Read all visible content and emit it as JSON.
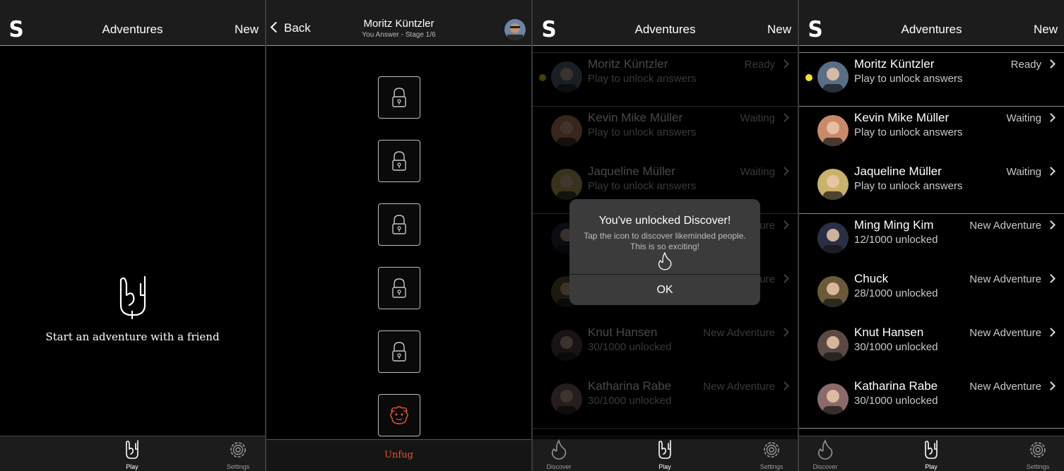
{
  "screen1": {
    "logo": "S",
    "title": "Adventures",
    "new_label": "New",
    "empty_text": "Start an adventure with a friend",
    "tabs": [
      {
        "label": "Play",
        "icon": "rock-hand-icon",
        "active": true
      },
      {
        "label": "Settings",
        "icon": "gear-icon",
        "active": false
      }
    ]
  },
  "screen2": {
    "back_label": "Back",
    "name": "Moritz Küntzler",
    "subtitle": "You Answer - Stage 1/6",
    "stages": [
      {
        "icon": "lock-icon"
      },
      {
        "icon": "lock-icon"
      },
      {
        "icon": "lock-icon"
      },
      {
        "icon": "lock-icon"
      },
      {
        "icon": "lock-icon"
      },
      {
        "icon": "mascot-icon"
      }
    ],
    "footer_label": "Unfug",
    "accent_color": "#e8562a"
  },
  "screen3": {
    "logo": "S",
    "title": "Adventures",
    "new_label": "New",
    "alert": {
      "title": "You've unlocked Discover!",
      "message": "Tap the icon to discover likeminded people. This is so exciting!",
      "ok_label": "OK",
      "icon": "flame-icon"
    },
    "tabs": [
      {
        "label": "Discover",
        "icon": "flame-icon"
      },
      {
        "label": "Play",
        "icon": "rock-hand-icon"
      },
      {
        "label": "Settings",
        "icon": "gear-icon"
      }
    ]
  },
  "screen4": {
    "logo": "S",
    "title": "Adventures",
    "new_label": "New",
    "tabs": [
      {
        "label": "Discover",
        "icon": "flame-icon"
      },
      {
        "label": "Play",
        "icon": "rock-hand-icon"
      },
      {
        "label": "Settings",
        "icon": "gear-icon"
      }
    ]
  },
  "friends": [
    {
      "name": "Moritz Küntzler",
      "sub": "Play to unlock answers",
      "status": "Ready",
      "unread": true,
      "avatar_color": "#5a6f86"
    },
    {
      "name": "Kevin Mike Müller",
      "sub": "Play to unlock answers",
      "status": "Waiting",
      "unread": false,
      "avatar_color": "#c98a6a"
    },
    {
      "name": "Jaqueline Müller",
      "sub": "Play to unlock answers",
      "status": "Waiting",
      "unread": false,
      "avatar_color": "#c9b26a"
    },
    {
      "name": "Ming Ming Kim",
      "sub": "12/1000 unlocked",
      "status": "New Adventure",
      "unread": false,
      "avatar_color": "#2a2f45"
    },
    {
      "name": "Chuck",
      "sub": "28/1000 unlocked",
      "status": "New Adventure",
      "unread": false,
      "avatar_color": "#6b5a3a"
    },
    {
      "name": "Knut Hansen",
      "sub": "30/1000 unlocked",
      "status": "New Adventure",
      "unread": false,
      "avatar_color": "#5b4a44"
    },
    {
      "name": "Katharina Rabe",
      "sub": "30/1000 unlocked",
      "status": "New Adventure",
      "unread": false,
      "avatar_color": "#8a6a6a"
    }
  ]
}
